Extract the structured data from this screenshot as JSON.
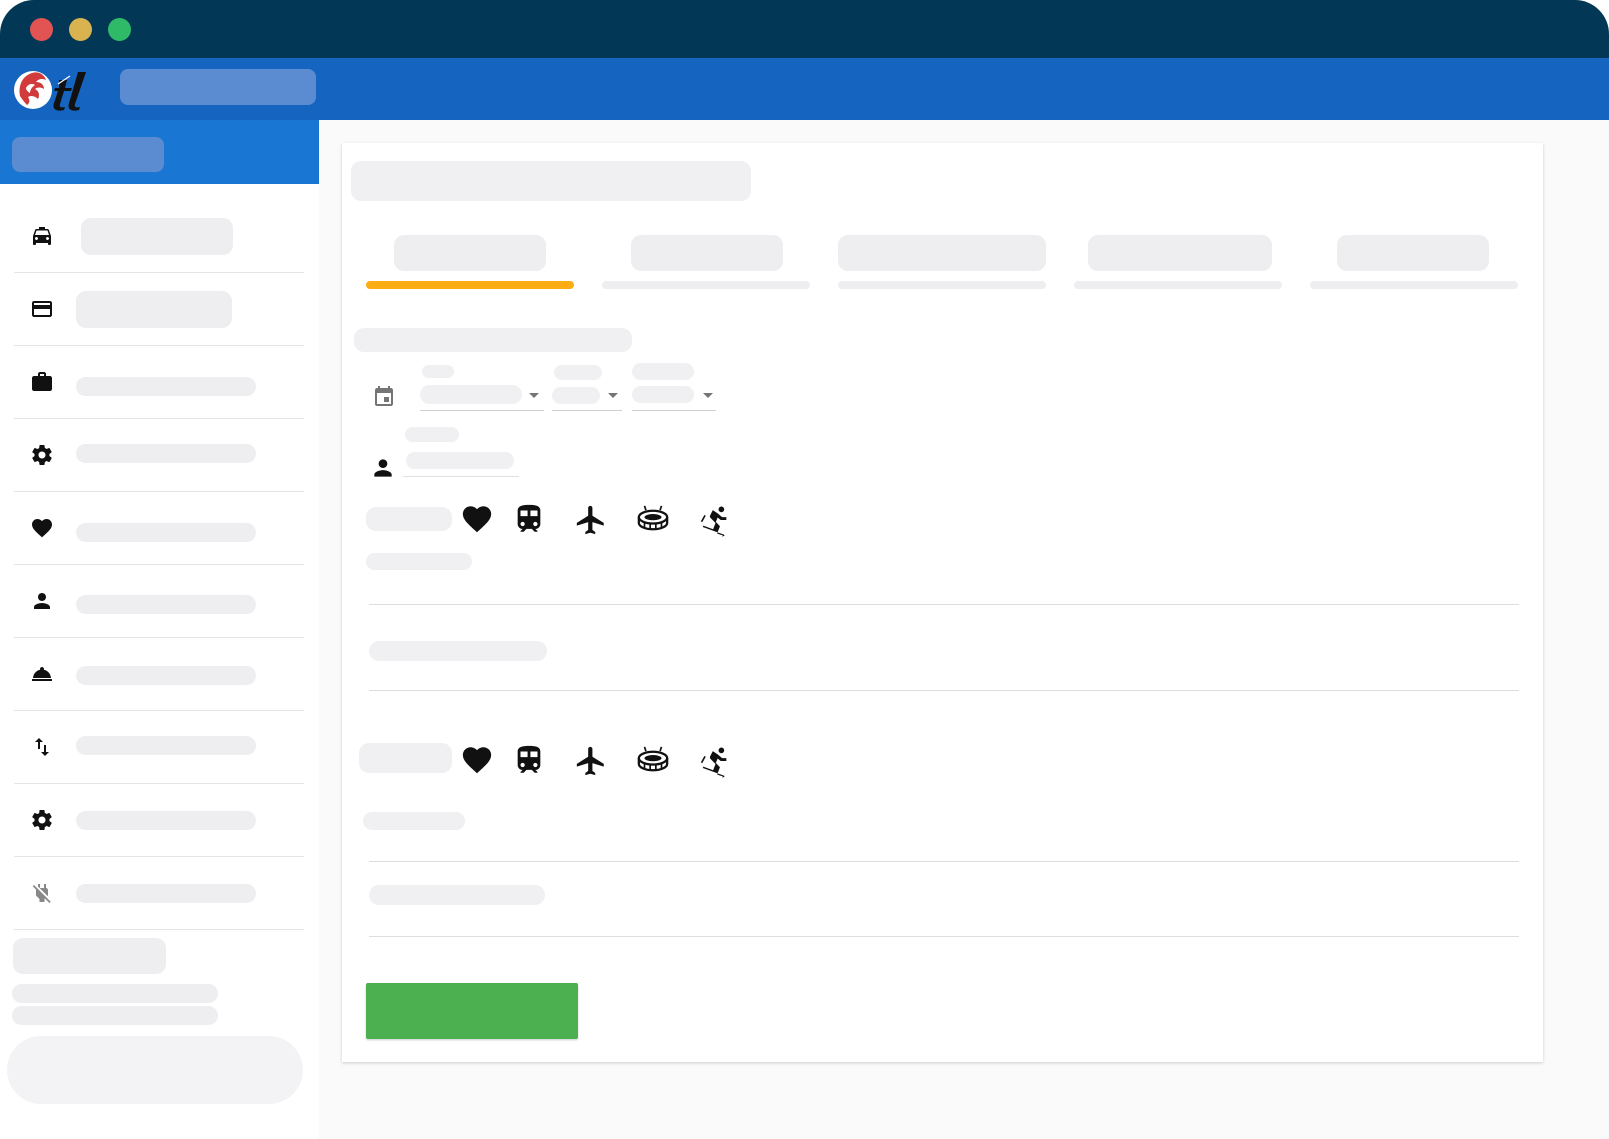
{
  "window": {
    "controls": [
      "close",
      "minimize",
      "maximize"
    ]
  },
  "header": {
    "logo_alt": "tl",
    "title": ""
  },
  "sidebar": {
    "title": "",
    "items": [
      {
        "icon": "taxi-icon",
        "label": ""
      },
      {
        "icon": "credit-card-icon",
        "label": ""
      },
      {
        "icon": "briefcase-icon",
        "label": ""
      },
      {
        "icon": "gear-icon",
        "label": ""
      },
      {
        "icon": "heart-icon",
        "label": ""
      },
      {
        "icon": "person-icon",
        "label": ""
      },
      {
        "icon": "room-service-icon",
        "label": ""
      },
      {
        "icon": "swap-vertical-icon",
        "label": ""
      },
      {
        "icon": "gear-icon",
        "label": ""
      },
      {
        "icon": "power-off-icon",
        "label": ""
      }
    ],
    "footer": {
      "heading": "",
      "line1": "",
      "line2": "",
      "button": ""
    }
  },
  "main": {
    "title": "",
    "tabs": [
      {
        "label": "",
        "active": true
      },
      {
        "label": "",
        "active": false
      },
      {
        "label": "",
        "active": false
      },
      {
        "label": "",
        "active": false
      },
      {
        "label": "",
        "active": false
      }
    ],
    "section_title": "",
    "date": {
      "day": "",
      "month": "",
      "year": ""
    },
    "person": {
      "label": "",
      "value": ""
    },
    "groups": [
      {
        "label": "",
        "icons": [
          "heart-icon",
          "train-icon",
          "airplane-icon",
          "stadium-icon",
          "ski-icon"
        ],
        "field1": "",
        "field2": ""
      },
      {
        "label": "",
        "icons": [
          "heart-icon",
          "train-icon",
          "airplane-icon",
          "stadium-icon",
          "ski-icon"
        ],
        "field1": "",
        "field2": ""
      }
    ],
    "submit_label": ""
  },
  "colors": {
    "titlebar": "#023856",
    "appbar": "#1565c0",
    "sidebar_head": "#1976d2",
    "active_tab": "#fbad13",
    "submit": "#4caf50"
  }
}
